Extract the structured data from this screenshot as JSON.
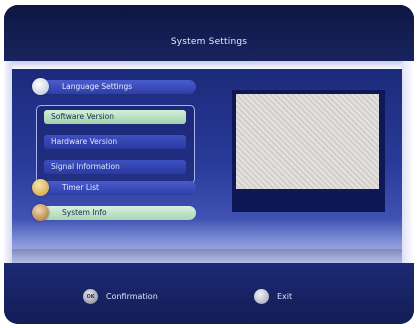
{
  "header": {
    "title": "System Settings"
  },
  "menu": {
    "items": [
      {
        "label": "Language Settings",
        "icon": "language-icon"
      },
      {
        "label": "Timer List",
        "icon": "timer-icon"
      },
      {
        "label": "System Info",
        "icon": "info-icon",
        "selected": true
      }
    ],
    "submenu": [
      {
        "label": "Software Version",
        "selected": true
      },
      {
        "label": "Hardware Version"
      },
      {
        "label": "Signal Information"
      }
    ]
  },
  "footer": {
    "ok_button": {
      "badge": "OK",
      "label": "Confirmation"
    },
    "exit_button": {
      "label": "Exit"
    }
  },
  "colors": {
    "background": "#121c4c",
    "panel": "#2a3c9c",
    "selected": "#b8e0c0"
  }
}
